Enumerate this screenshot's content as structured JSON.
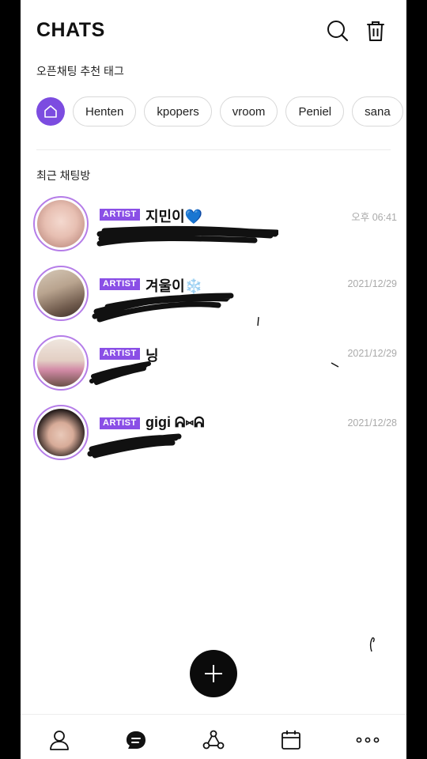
{
  "header": {
    "title": "CHATS"
  },
  "icons": {
    "search": "search-icon",
    "trash": "trash-icon",
    "home": "home-icon",
    "add": "plus-icon",
    "nav": [
      "person-icon",
      "chat-bubble-icon",
      "share-nodes-icon",
      "calendar-icon",
      "more-dots-icon"
    ]
  },
  "tags_section": {
    "label": "오픈채팅 추천 태그",
    "tags": [
      "Henten",
      "kpopers",
      "vroom",
      "Peniel",
      "sana"
    ]
  },
  "recent_section": {
    "label": "최근 채팅방"
  },
  "chats": [
    {
      "badge": "ARTIST",
      "name": "지민이💙",
      "time": "오후 06:41"
    },
    {
      "badge": "ARTIST",
      "name": "겨울이❄️",
      "time": "2021/12/29"
    },
    {
      "badge": "ARTIST",
      "name": "닝",
      "time": "2021/12/29"
    },
    {
      "badge": "ARTIST",
      "name": "gigi ᕱ⑅ᕱ",
      "time": "2021/12/28"
    }
  ],
  "colors": {
    "accent": "#7c4ce0",
    "badge": "#8a4fe6",
    "avatar_ring": "#b57de8",
    "fab": "#0b0b0b"
  }
}
